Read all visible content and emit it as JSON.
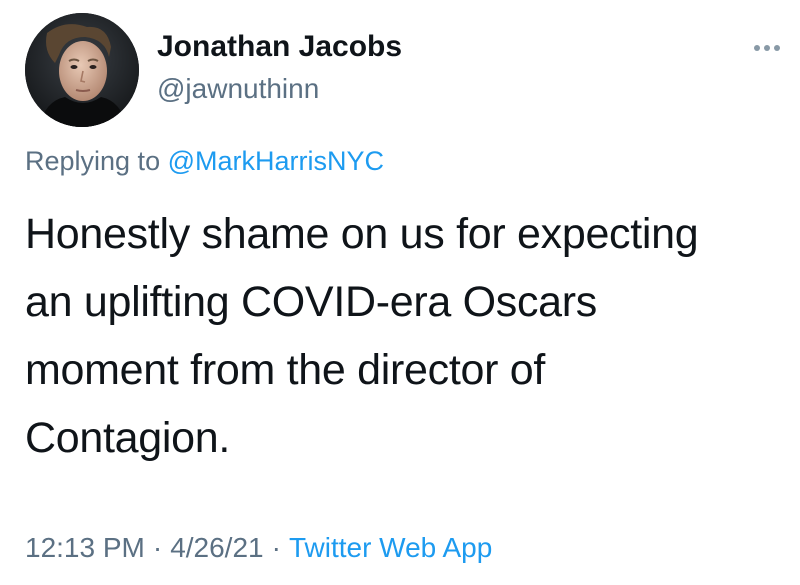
{
  "author": {
    "display_name": "Jonathan Jacobs",
    "handle": "@jawnuthinn",
    "avatar_icon": "profile-photo"
  },
  "more_menu": {
    "icon": "more-horizontal-icon"
  },
  "reply_context": {
    "prefix": "Replying to",
    "mention": "@MarkHarrisNYC"
  },
  "tweet": {
    "lines": [
      "Honestly shame on us for expecting",
      "an uplifting COVID-era Oscars",
      "moment from the director of",
      "Contagion."
    ]
  },
  "meta": {
    "time": "12:13 PM",
    "separator": "·",
    "date": "4/26/21",
    "source": "Twitter Web App"
  },
  "colors": {
    "text_primary": "#0f1419",
    "text_secondary": "#5b7083",
    "link": "#1d9bf0"
  }
}
